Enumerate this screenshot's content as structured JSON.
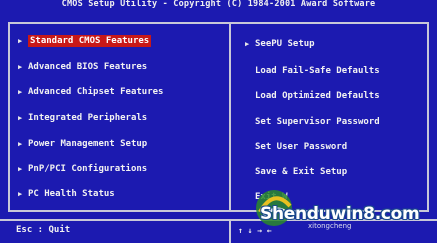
{
  "window": {
    "title": "CMOS Setup Utility - Copyright (C) 1984-2001 Award Software"
  },
  "left_menu": [
    {
      "label": "Standard CMOS Features",
      "selected": true
    },
    {
      "label": "Advanced BIOS Features",
      "selected": false
    },
    {
      "label": "Advanced Chipset Features",
      "selected": false
    },
    {
      "label": "Integrated Peripherals",
      "selected": false
    },
    {
      "label": "Power Management Setup",
      "selected": false
    },
    {
      "label": "PnP/PCI Configurations",
      "selected": false
    },
    {
      "label": "PC Health Status",
      "selected": false
    }
  ],
  "right_menu": [
    {
      "label": "SeePU Setup",
      "arrow": true
    },
    {
      "label": "Load Fail-Safe Defaults",
      "arrow": false
    },
    {
      "label": "Load Optimized Defaults",
      "arrow": false
    },
    {
      "label": "Set Supervisor Password",
      "arrow": false
    },
    {
      "label": "Set User Password",
      "arrow": false
    },
    {
      "label": "Save & Exit Setup",
      "arrow": false
    },
    {
      "label": "Exit W",
      "arrow": false
    }
  ],
  "footer": {
    "left": "Esc : Quit",
    "right": "↑ ↓ → ←"
  },
  "watermark": {
    "text": "Shenduwin8.com",
    "sub": "xitongcheng"
  },
  "colors": {
    "background": "#1c1ab0",
    "selection": "#c81818",
    "text": "#f2f2f2",
    "border": "#c8c8d8"
  }
}
